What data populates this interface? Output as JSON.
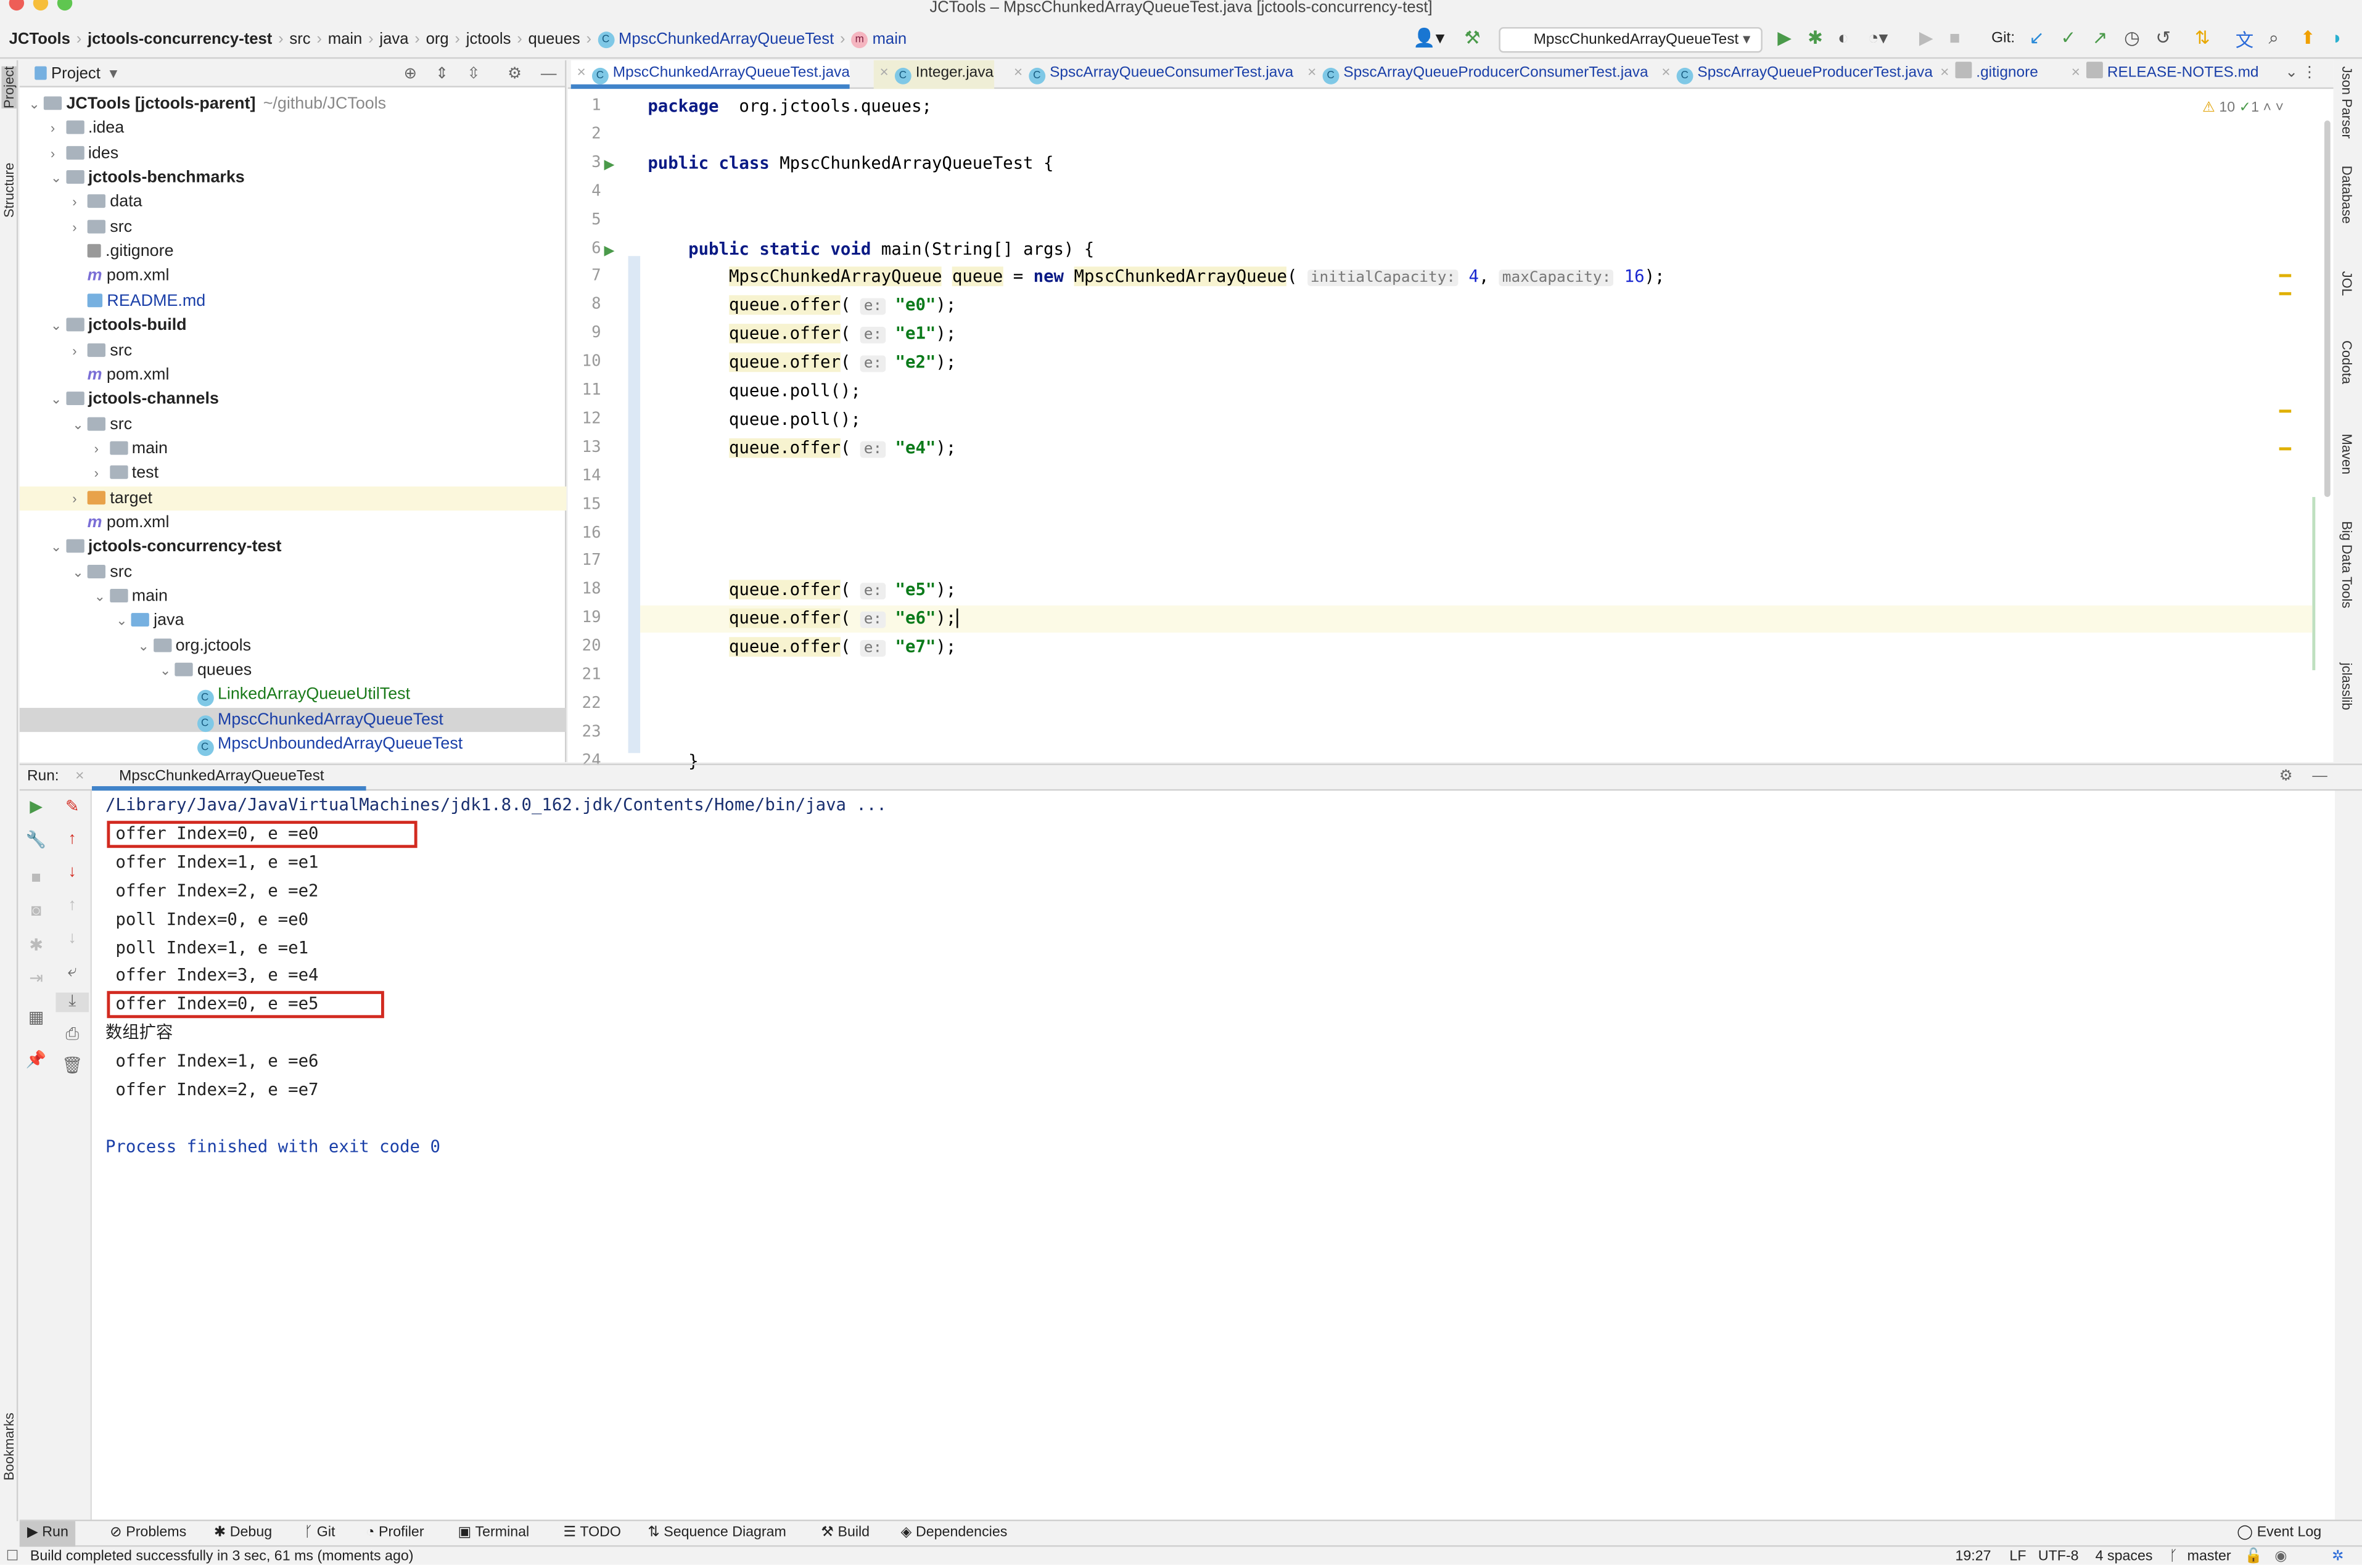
{
  "window": {
    "title": "JCTools – MpscChunkedArrayQueueTest.java [jctools-concurrency-test]"
  },
  "breadcrumb": [
    "JCTools",
    "jctools-concurrency-test",
    "src",
    "main",
    "java",
    "org",
    "jctools",
    "queues",
    "MpscChunkedArrayQueueTest",
    "main"
  ],
  "toolbar": {
    "run_config": "MpscChunkedArrayQueueTest",
    "git_label": "Git:"
  },
  "left_strip": {
    "project": "Project",
    "structure": "Structure",
    "bookmarks": "Bookmarks"
  },
  "right_strip": [
    "Json Parser",
    "Database",
    "JOL",
    "Codota",
    "Maven",
    "Big Data Tools",
    "jclasslib"
  ],
  "project": {
    "header": "Project",
    "tree": [
      {
        "label": "JCTools [jctools-parent]",
        "extra": "~/github/JCTools",
        "depth": 0,
        "kind": "folder",
        "exp": "open",
        "bold": true
      },
      {
        "label": ".idea",
        "depth": 1,
        "kind": "folder",
        "exp": "closed"
      },
      {
        "label": "ides",
        "depth": 1,
        "kind": "folder",
        "exp": "closed"
      },
      {
        "label": "jctools-benchmarks",
        "depth": 1,
        "kind": "folder",
        "exp": "open",
        "bold": true
      },
      {
        "label": "data",
        "depth": 2,
        "kind": "folder",
        "exp": "closed"
      },
      {
        "label": "src",
        "depth": 2,
        "kind": "folder",
        "exp": "closed"
      },
      {
        "label": ".gitignore",
        "depth": 2,
        "kind": "file"
      },
      {
        "label": "pom.xml",
        "depth": 2,
        "kind": "maven"
      },
      {
        "label": "README.md",
        "depth": 2,
        "kind": "md",
        "color": "#1a3fa8"
      },
      {
        "label": "jctools-build",
        "depth": 1,
        "kind": "folder",
        "exp": "open",
        "bold": true
      },
      {
        "label": "src",
        "depth": 2,
        "kind": "folder",
        "exp": "closed"
      },
      {
        "label": "pom.xml",
        "depth": 2,
        "kind": "maven"
      },
      {
        "label": "jctools-channels",
        "depth": 1,
        "kind": "folder",
        "exp": "open",
        "bold": true
      },
      {
        "label": "src",
        "depth": 2,
        "kind": "folder",
        "exp": "open"
      },
      {
        "label": "main",
        "depth": 3,
        "kind": "folder",
        "exp": "closed"
      },
      {
        "label": "test",
        "depth": 3,
        "kind": "folder",
        "exp": "closed"
      },
      {
        "label": "target",
        "depth": 2,
        "kind": "folder-orange",
        "exp": "closed",
        "hl": true
      },
      {
        "label": "pom.xml",
        "depth": 2,
        "kind": "maven"
      },
      {
        "label": "jctools-concurrency-test",
        "depth": 1,
        "kind": "folder",
        "exp": "open",
        "bold": true
      },
      {
        "label": "src",
        "depth": 2,
        "kind": "folder",
        "exp": "open"
      },
      {
        "label": "main",
        "depth": 3,
        "kind": "folder",
        "exp": "open"
      },
      {
        "label": "java",
        "depth": 4,
        "kind": "folder-blue",
        "exp": "open"
      },
      {
        "label": "org.jctools",
        "depth": 5,
        "kind": "folder",
        "exp": "open"
      },
      {
        "label": "queues",
        "depth": 6,
        "kind": "folder",
        "exp": "open"
      },
      {
        "label": "LinkedArrayQueueUtilTest",
        "depth": 7,
        "kind": "class",
        "color": "#1a7a1a"
      },
      {
        "label": "MpscChunkedArrayQueueTest",
        "depth": 7,
        "kind": "class",
        "color": "#1a3fa8",
        "sel": true
      },
      {
        "label": "MpscUnboundedArrayQueueTest",
        "depth": 7,
        "kind": "class",
        "color": "#1a3fa8"
      }
    ]
  },
  "editor": {
    "tabs": [
      {
        "label": "MpscChunkedArrayQueueTest.java",
        "active": true
      },
      {
        "label": "Integer.java"
      },
      {
        "label": "SpscArrayQueueConsumerTest.java"
      },
      {
        "label": "SpscArrayQueueProducerConsumerTest.java"
      },
      {
        "label": "SpscArrayQueueProducerTest.java"
      },
      {
        "label": ".gitignore"
      },
      {
        "label": "RELEASE-NOTES.md"
      }
    ],
    "warnings": "10",
    "checks": "1",
    "lines": [
      [
        [
          "kw",
          "package"
        ],
        [
          "",
          "  org.jctools.queues;"
        ]
      ],
      [],
      [
        [
          "kw",
          "public class"
        ],
        [
          "",
          " MpscChunkedArrayQueueTest {"
        ]
      ],
      [],
      [],
      [
        [
          "",
          "    "
        ],
        [
          "kw",
          "public static void"
        ],
        [
          "",
          " main(String[] args) {"
        ]
      ],
      [
        [
          "",
          "        "
        ],
        [
          "ylw",
          "MpscChunkedArrayQueue"
        ],
        [
          "",
          " "
        ],
        [
          "ylw",
          "queue"
        ],
        [
          "",
          " = "
        ],
        [
          "kw",
          "new"
        ],
        [
          "",
          " "
        ],
        [
          "ylw",
          "MpscChunkedArrayQueue"
        ],
        [
          "",
          "( "
        ],
        [
          "hint",
          "initialCapacity:"
        ],
        [
          "",
          " "
        ],
        [
          "num",
          "4"
        ],
        [
          "",
          ", "
        ],
        [
          "hint",
          "maxCapacity:"
        ],
        [
          "",
          " "
        ],
        [
          "num",
          "16"
        ],
        [
          "",
          ");"
        ]
      ],
      [
        [
          "",
          "        "
        ],
        [
          "ylw",
          "queue.offer"
        ],
        [
          "",
          "( "
        ],
        [
          "hint",
          "e:"
        ],
        [
          "",
          " "
        ],
        [
          "str",
          "\"e0\""
        ],
        [
          "",
          ");"
        ]
      ],
      [
        [
          "",
          "        "
        ],
        [
          "ylw",
          "queue.offer"
        ],
        [
          "",
          "( "
        ],
        [
          "hint",
          "e:"
        ],
        [
          "",
          " "
        ],
        [
          "str",
          "\"e1\""
        ],
        [
          "",
          ");"
        ]
      ],
      [
        [
          "",
          "        "
        ],
        [
          "ylw",
          "queue.offer"
        ],
        [
          "",
          "( "
        ],
        [
          "hint",
          "e:"
        ],
        [
          "",
          " "
        ],
        [
          "str",
          "\"e2\""
        ],
        [
          "",
          ");"
        ]
      ],
      [
        [
          "",
          "        queue.poll();"
        ]
      ],
      [
        [
          "",
          "        queue.poll();"
        ]
      ],
      [
        [
          "",
          "        "
        ],
        [
          "ylw",
          "queue.offer"
        ],
        [
          "",
          "( "
        ],
        [
          "hint",
          "e:"
        ],
        [
          "",
          " "
        ],
        [
          "str",
          "\"e4\""
        ],
        [
          "",
          ");"
        ]
      ],
      [],
      [],
      [],
      [],
      [
        [
          "",
          "        "
        ],
        [
          "ylw",
          "queue.offer"
        ],
        [
          "",
          "( "
        ],
        [
          "hint",
          "e:"
        ],
        [
          "",
          " "
        ],
        [
          "str",
          "\"e5\""
        ],
        [
          "",
          ");"
        ]
      ],
      [
        [
          "",
          "        "
        ],
        [
          "ylw",
          "queue.offer"
        ],
        [
          "",
          "( "
        ],
        [
          "hint",
          "e:"
        ],
        [
          "",
          " "
        ],
        [
          "str",
          "\"e6\""
        ],
        [
          "",
          ");"
        ]
      ],
      [
        [
          "",
          "        "
        ],
        [
          "ylw",
          "queue.offer"
        ],
        [
          "",
          "( "
        ],
        [
          "hint",
          "e:"
        ],
        [
          "",
          " "
        ],
        [
          "str",
          "\"e7\""
        ],
        [
          "",
          ");"
        ]
      ],
      [],
      [],
      [],
      [
        [
          "",
          "    }"
        ]
      ]
    ]
  },
  "run": {
    "label": "Run:",
    "tab": "MpscChunkedArrayQueueTest",
    "cmd": "/Library/Java/JavaVirtualMachines/jdk1.8.0_162.jdk/Contents/Home/bin/java ...",
    "output": [
      " offer Index=0, e =e0",
      " offer Index=1, e =e1",
      " offer Index=2, e =e2",
      " poll Index=0, e =e0",
      " poll Index=1, e =e1",
      " offer Index=3, e =e4",
      " offer Index=0, e =e5",
      "数组扩容",
      " offer Index=1, e =e6",
      " offer Index=2, e =e7",
      ""
    ],
    "exit": "Process finished with exit code 0",
    "highlight_color": "#d22a20"
  },
  "bottom_tools": [
    "Run",
    "Problems",
    "Debug",
    "Git",
    "Profiler",
    "Terminal",
    "TODO",
    "Sequence Diagram",
    "Build",
    "Dependencies"
  ],
  "event_log": "Event Log",
  "status": {
    "message": "Build completed successfully in 3 sec, 61 ms (moments ago)",
    "position": "19:27",
    "line_sep": "LF",
    "encoding": "UTF-8",
    "indent": "4 spaces",
    "branch": "master"
  }
}
